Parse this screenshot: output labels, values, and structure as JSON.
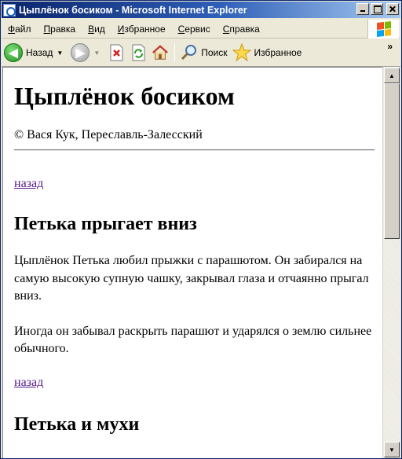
{
  "window": {
    "title": "Цыплёнок босиком - Microsoft Internet Explorer"
  },
  "menu": {
    "items": [
      "Файл",
      "Правка",
      "Вид",
      "Избранное",
      "Сервис",
      "Справка"
    ]
  },
  "toolbar": {
    "back_label": "Назад",
    "search_label": "Поиск",
    "favorites_label": "Избранное",
    "overflow": "»"
  },
  "page": {
    "title": "Цыплёнок босиком",
    "byline": "© Вася Кук, Переславль-Залесский",
    "back_link": "назад",
    "section1_heading": "Петька прыгает вниз",
    "section1_p1": "Цыплёнок Петька любил прыжки с парашютом. Он забирался на самую высокую супную чашку, закрывал глаза и отчаянно прыгал вниз.",
    "section1_p2": "Иногда он забывал раскрыть парашют и ударялся о землю сильнее обычного.",
    "back_link_2": "назад",
    "section2_heading": "Петька и мухи"
  },
  "colors": {
    "titlebar_start": "#0a246a",
    "visited_link": "#551a8b",
    "chrome": "#ece9d8"
  },
  "icons": [
    "ie-icon",
    "back-arrow-icon",
    "forward-arrow-icon",
    "stop-icon",
    "refresh-icon",
    "home-icon",
    "search-icon",
    "favorites-star-icon",
    "windows-logo-icon"
  ]
}
